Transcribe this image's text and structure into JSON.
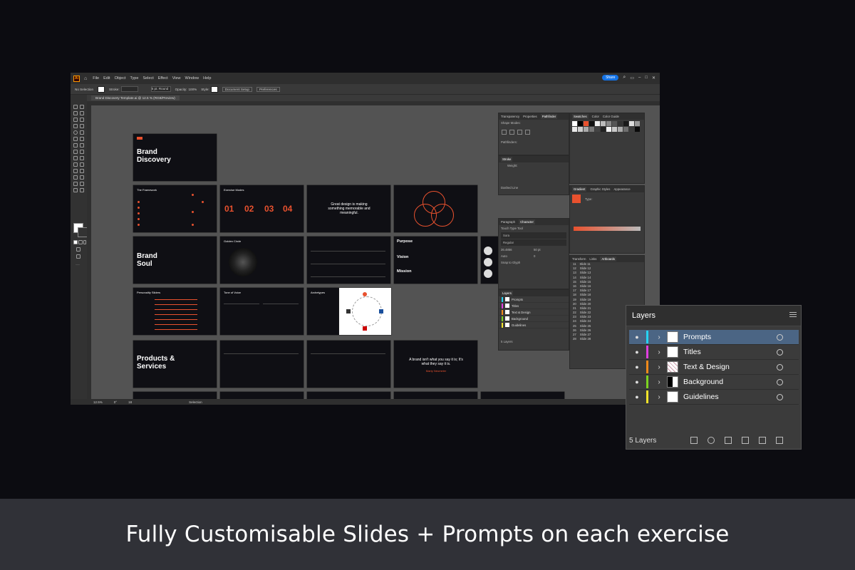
{
  "menubar": {
    "items": [
      "File",
      "Edit",
      "Object",
      "Type",
      "Select",
      "Effect",
      "View",
      "Window",
      "Help"
    ],
    "share_label": "Share"
  },
  "control_bar": {
    "selection": "No Selection",
    "stroke_label": "Stroke:",
    "brush": "5 pt. Round",
    "opacity_label": "Opacity:",
    "opacity_value": "100%",
    "style_label": "Style:",
    "document_setup": "Document Setup",
    "preferences": "Preferences"
  },
  "document_tab": "Brand Discovery Template.ai @ 12.5 % (RGB/Preview)",
  "status": {
    "zoom": "12.5%",
    "angle": "0°",
    "artboard": "18",
    "mode": "Selection"
  },
  "slides": {
    "brand_discovery": "Brand Discovery",
    "framework": "The Framework",
    "exercise_modes": "Exercise Modes",
    "nums": [
      "01",
      "02",
      "03",
      "04"
    ],
    "great_design": "Great design is making something memorable and meaningful.",
    "brand_soul": "Brand Soul",
    "golden_circle": "Golden Circle",
    "purpose": "Purpose",
    "vision": "Vision",
    "mission": "Mission",
    "personality": "Personality Sliders",
    "tone": "Tone of Voice",
    "archetypes": "Archetypes",
    "products": "Products & Services",
    "brand_quote": "A brand isn't what you say it is; It's what they say it is.",
    "quote_author": "Marty Neumeier"
  },
  "panels": {
    "properties_tabs": [
      "Transparency",
      "Properties",
      "Pathfinder"
    ],
    "shape_modes": "Shape Modes:",
    "pathfinders": "Pathfinders:",
    "stroke": "Stroke",
    "weight": "Weight:",
    "dashed_line": "Dashed Line",
    "para_tabs": [
      "Paragraph",
      "Character"
    ],
    "touch_type": "Touch Type Tool",
    "font": "Sora",
    "font_style": "Regular",
    "font_size": "26.4856",
    "leading": "Auto",
    "tracking": "50 pt",
    "kerning": "0",
    "snap": "Snap to Glyph",
    "swatch_tabs": [
      "Swatches",
      "Color",
      "Color Guide"
    ],
    "gradient_tabs": [
      "Gradient",
      "Graphic Styles",
      "Appearance"
    ],
    "type_label": "Type:",
    "artboard_tabs": [
      "Transform",
      "Links",
      "Artboards"
    ],
    "artboards": [
      {
        "n": "11",
        "name": "Slide 11"
      },
      {
        "n": "12",
        "name": "Slide 12"
      },
      {
        "n": "13",
        "name": "Slide 13"
      },
      {
        "n": "14",
        "name": "Slide 14"
      },
      {
        "n": "15",
        "name": "Slide 15"
      },
      {
        "n": "16",
        "name": "Slide 16"
      },
      {
        "n": "17",
        "name": "Slide 17"
      },
      {
        "n": "18",
        "name": "Slide 18"
      },
      {
        "n": "19",
        "name": "Slide 19"
      },
      {
        "n": "20",
        "name": "Slide 20"
      },
      {
        "n": "21",
        "name": "Slide 21"
      },
      {
        "n": "22",
        "name": "Slide 22"
      },
      {
        "n": "23",
        "name": "Slide 23"
      },
      {
        "n": "24",
        "name": "Slide 24"
      },
      {
        "n": "25",
        "name": "Slide 25"
      },
      {
        "n": "26",
        "name": "Slide 26"
      },
      {
        "n": "27",
        "name": "Slide 27"
      },
      {
        "n": "28",
        "name": "Slide 28"
      }
    ],
    "small_layers_title": "Layers",
    "small_layers_count": "5 Layers"
  },
  "layers_panel": {
    "title": "Layers",
    "count": "5 Layers",
    "layers": [
      {
        "name": "Prompts",
        "color": "#27d3f2",
        "selected": true
      },
      {
        "name": "Titles",
        "color": "#e040e0",
        "selected": false
      },
      {
        "name": "Text & Design",
        "color": "#f28a1a",
        "selected": false
      },
      {
        "name": "Background",
        "color": "#7dd321",
        "selected": false
      },
      {
        "name": "Guidelines",
        "color": "#f2e32a",
        "selected": false
      }
    ]
  },
  "caption": "Fully Customisable Slides + Prompts on each exercise",
  "colors": {
    "accent": "#e8512e",
    "selection": "#4b6584",
    "app_bg": "#434343"
  }
}
